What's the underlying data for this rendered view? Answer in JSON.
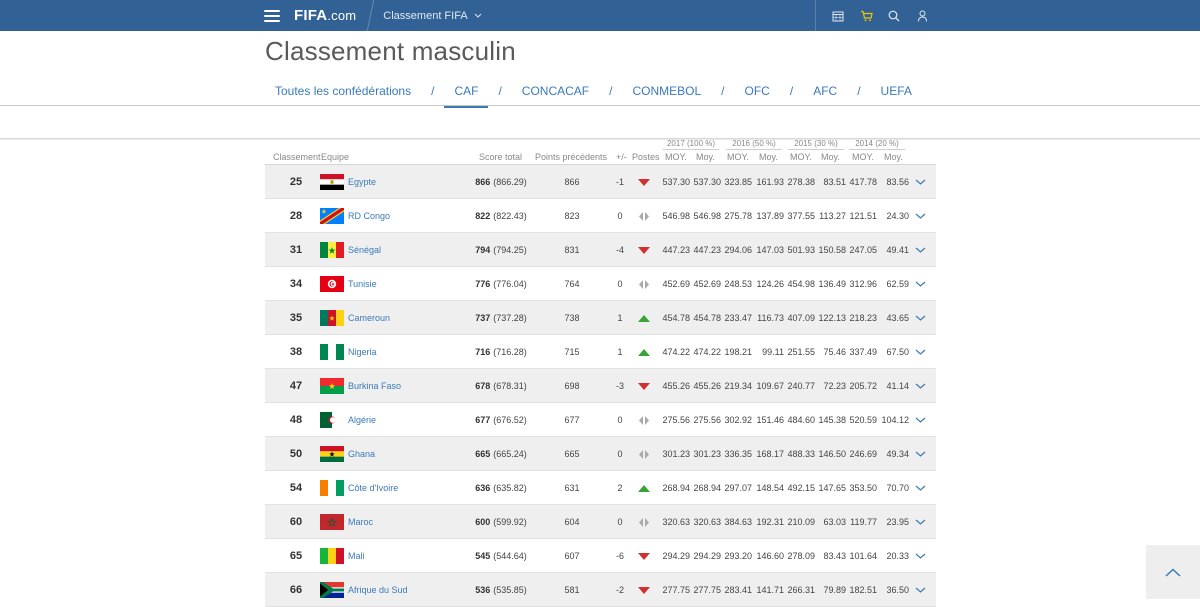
{
  "nav": {
    "logo": "FIFA",
    "logo_suffix": ".com",
    "dropdown_label": "Classement FIFA"
  },
  "page": {
    "title": "Classement masculin"
  },
  "tabs": [
    {
      "label": "Toutes les confédérations",
      "active": false
    },
    {
      "label": "CAF",
      "active": true
    },
    {
      "label": "CONCACAF",
      "active": false
    },
    {
      "label": "CONMEBOL",
      "active": false
    },
    {
      "label": "OFC",
      "active": false
    },
    {
      "label": "AFC",
      "active": false
    },
    {
      "label": "UEFA",
      "active": false
    }
  ],
  "tab_separator": "/",
  "table": {
    "years": [
      "2017 (100 %)",
      "2016 (50 %)",
      "2015 (30 %)",
      "2014 (20 %)"
    ],
    "columns": {
      "rank": "Classement",
      "team": "Equipe",
      "score": "Score total",
      "prev": "Points précédents",
      "diff": "+/-",
      "positions": "Postes",
      "avg": "MOY.",
      "weighted": "Moy."
    },
    "rows": [
      {
        "rank": "25",
        "team": "Egypte",
        "flag": "egypt",
        "score": "866",
        "score_exact": "(866.29)",
        "prev": "866",
        "diff": "-1",
        "trend": "down",
        "vals": [
          "537.30",
          "537.30",
          "323.85",
          "161.93",
          "278.38",
          "83.51",
          "417.78",
          "83.56"
        ]
      },
      {
        "rank": "28",
        "team": "RD Congo",
        "flag": "drc",
        "score": "822",
        "score_exact": "(822.43)",
        "prev": "823",
        "diff": "0",
        "trend": "same",
        "vals": [
          "546.98",
          "546.98",
          "275.78",
          "137.89",
          "377.55",
          "113.27",
          "121.51",
          "24.30"
        ]
      },
      {
        "rank": "31",
        "team": "Sénégal",
        "flag": "senegal",
        "score": "794",
        "score_exact": "(794.25)",
        "prev": "831",
        "diff": "-4",
        "trend": "down",
        "vals": [
          "447.23",
          "447.23",
          "294.06",
          "147.03",
          "501.93",
          "150.58",
          "247.05",
          "49.41"
        ]
      },
      {
        "rank": "34",
        "team": "Tunisie",
        "flag": "tunisia",
        "score": "776",
        "score_exact": "(776.04)",
        "prev": "764",
        "diff": "0",
        "trend": "same",
        "vals": [
          "452.69",
          "452.69",
          "248.53",
          "124.26",
          "454.98",
          "136.49",
          "312.96",
          "62.59"
        ]
      },
      {
        "rank": "35",
        "team": "Cameroun",
        "flag": "cameroon",
        "score": "737",
        "score_exact": "(737.28)",
        "prev": "738",
        "diff": "1",
        "trend": "up",
        "vals": [
          "454.78",
          "454.78",
          "233.47",
          "116.73",
          "407.09",
          "122.13",
          "218.23",
          "43.65"
        ]
      },
      {
        "rank": "38",
        "team": "Nigeria",
        "flag": "nigeria",
        "score": "716",
        "score_exact": "(716.28)",
        "prev": "715",
        "diff": "1",
        "trend": "up",
        "vals": [
          "474.22",
          "474.22",
          "198.21",
          "99.11",
          "251.55",
          "75.46",
          "337.49",
          "67.50"
        ]
      },
      {
        "rank": "47",
        "team": "Burkina Faso",
        "flag": "burkina",
        "score": "678",
        "score_exact": "(678.31)",
        "prev": "698",
        "diff": "-3",
        "trend": "down",
        "vals": [
          "455.26",
          "455.26",
          "219.34",
          "109.67",
          "240.77",
          "72.23",
          "205.72",
          "41.14"
        ]
      },
      {
        "rank": "48",
        "team": "Algérie",
        "flag": "algeria",
        "score": "677",
        "score_exact": "(676.52)",
        "prev": "677",
        "diff": "0",
        "trend": "same",
        "vals": [
          "275.56",
          "275.56",
          "302.92",
          "151.46",
          "484.60",
          "145.38",
          "520.59",
          "104.12"
        ]
      },
      {
        "rank": "50",
        "team": "Ghana",
        "flag": "ghana",
        "score": "665",
        "score_exact": "(665.24)",
        "prev": "665",
        "diff": "0",
        "trend": "same",
        "vals": [
          "301.23",
          "301.23",
          "336.35",
          "168.17",
          "488.33",
          "146.50",
          "246.69",
          "49.34"
        ]
      },
      {
        "rank": "54",
        "team": "Côte d'Ivoire",
        "flag": "ivory",
        "score": "636",
        "score_exact": "(635.82)",
        "prev": "631",
        "diff": "2",
        "trend": "up",
        "vals": [
          "268.94",
          "268.94",
          "297.07",
          "148.54",
          "492.15",
          "147.65",
          "353.50",
          "70.70"
        ]
      },
      {
        "rank": "60",
        "team": "Maroc",
        "flag": "morocco",
        "score": "600",
        "score_exact": "(599.92)",
        "prev": "604",
        "diff": "0",
        "trend": "same",
        "vals": [
          "320.63",
          "320.63",
          "384.63",
          "192.31",
          "210.09",
          "63.03",
          "119.77",
          "23.95"
        ]
      },
      {
        "rank": "65",
        "team": "Mali",
        "flag": "mali",
        "score": "545",
        "score_exact": "(544.64)",
        "prev": "607",
        "diff": "-6",
        "trend": "down",
        "vals": [
          "294.29",
          "294.29",
          "293.20",
          "146.60",
          "278.09",
          "83.43",
          "101.64",
          "20.33"
        ]
      },
      {
        "rank": "66",
        "team": "Afrique du Sud",
        "flag": "southafrica",
        "score": "536",
        "score_exact": "(535.85)",
        "prev": "581",
        "diff": "-2",
        "trend": "down",
        "vals": [
          "277.75",
          "277.75",
          "283.41",
          "141.71",
          "266.31",
          "79.89",
          "182.51",
          "36.50"
        ]
      }
    ]
  },
  "colors": {
    "nav_bg": "#326295",
    "link": "#3a7ab8",
    "trend_up": "#3aa335",
    "trend_down": "#d0312d",
    "trend_same": "#aaaaaa"
  }
}
